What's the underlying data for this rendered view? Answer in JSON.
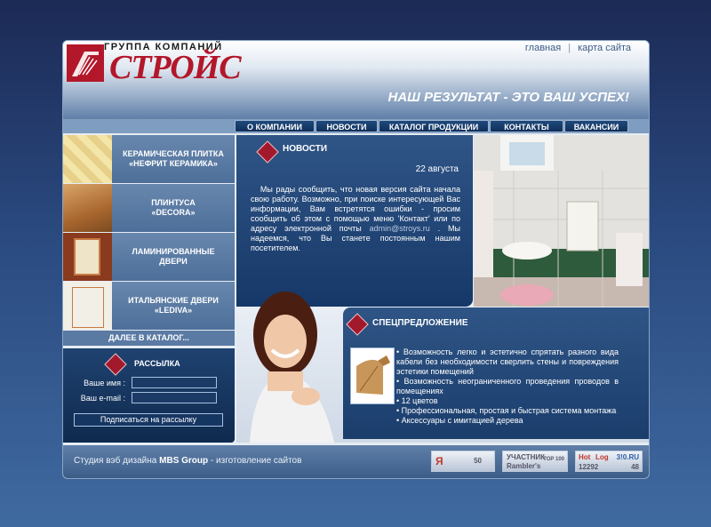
{
  "header": {
    "logo_top": "ГРУППА КОМПАНИЙ",
    "logo_main": "СТРОЙС",
    "links": [
      "главная",
      "карта сайта"
    ],
    "separator": "|",
    "slogan": "НАШ РЕЗУЛЬТАТ - ЭТО ВАШ УСПЕХ!"
  },
  "nav": [
    "О КОМПАНИИ",
    "НОВОСТИ",
    "КАТАЛОГ ПРОДУКЦИИ",
    "КОНТАКТЫ",
    "ВАКАНСИИ"
  ],
  "sidebar": {
    "items": [
      {
        "label_line1": "КЕРАМИЧЕСКАЯ ПЛИТКА",
        "label_line2": "«НЕФРИТ КЕРАМИКА»"
      },
      {
        "label_line1": "ПЛИНТУСА",
        "label_line2": "«DECORA»"
      },
      {
        "label_line1": "ЛАМИНИРОВАННЫЕ",
        "label_line2": "ДВЕРИ"
      },
      {
        "label_line1": "ИТАЛЬЯНСКИЕ ДВЕРИ",
        "label_line2": "«LEDIVA»"
      }
    ],
    "catalog_link": "ДАЛЕЕ В КАТАЛОГ..."
  },
  "newsletter": {
    "title": "РАССЫЛКА",
    "name_label": "Ваше имя :",
    "email_label": "Ваш e-mail :",
    "name_value": "",
    "email_value": "",
    "button": "Подписаться на рассылку"
  },
  "news": {
    "title": "НОВОСТИ",
    "date": "22 августа",
    "body_before": "Мы рады сообщить, что новая версия сайта начала свою работу. Возможно, при поиске интересующей Вас информации, Вам встретятся ошибки - просим сообщить об этом с помощью меню 'Контакт' или по адресу электронной почты",
    "email": "admin@stroys.ru",
    "body_after": ". Мы надеемся, что Вы станете постоянным нашим посетителем."
  },
  "special": {
    "title": "СПЕЦПРЕДЛОЖЕНИЕ",
    "items": [
      "• Возможность легко и эстетично спрятать разного вида кабели без необходимости сверлить стены и повреждения эстетики помещений",
      "• Возможность неограниченного проведения проводов в помещениях",
      "• 12 цветов",
      "• Профессиональная, простая и быстрая система монтажа",
      "• Аксессуары с имитацией дерева"
    ]
  },
  "footer": {
    "prefix": "Студия вэб дизайна",
    "studio": "MBS Group",
    "suffix": "- изготовление сайтов",
    "counter1": {
      "letter": "Я",
      "value": "50"
    },
    "counter2": {
      "top": "УЧАСТНИК",
      "bottom": "Rambler's",
      "badge": "TOP 100"
    },
    "counter3": {
      "left": "Hot",
      "right": "Log",
      "brand": "3!0.RU",
      "value": "12292",
      "extra": "48"
    }
  },
  "colors": {
    "brand_red": "#b3172a",
    "nav_dark": "#0f2f5a",
    "panel_blue": "#1f4270"
  }
}
